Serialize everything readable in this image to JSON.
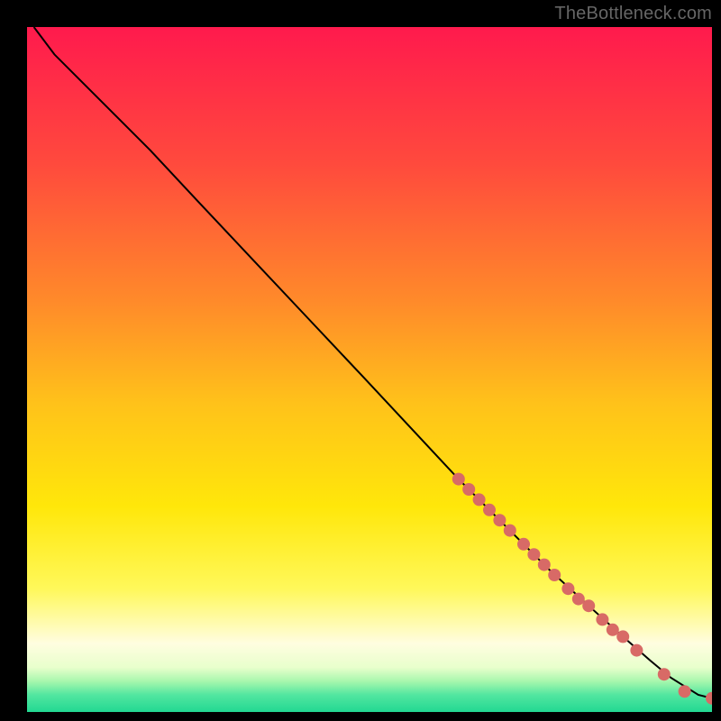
{
  "watermark": "TheBottleneck.com",
  "chart_data": {
    "type": "line",
    "title": "",
    "xlabel": "",
    "ylabel": "",
    "xlim": [
      0,
      100
    ],
    "ylim": [
      0,
      100
    ],
    "grid": false,
    "legend": false,
    "background_gradient_stops": [
      {
        "offset": 0.0,
        "color": "#ff1a4d"
      },
      {
        "offset": 0.2,
        "color": "#ff4a3d"
      },
      {
        "offset": 0.4,
        "color": "#ff8a2a"
      },
      {
        "offset": 0.55,
        "color": "#ffc21a"
      },
      {
        "offset": 0.7,
        "color": "#ffe70a"
      },
      {
        "offset": 0.82,
        "color": "#fff85a"
      },
      {
        "offset": 0.9,
        "color": "#fffde0"
      },
      {
        "offset": 0.935,
        "color": "#e8ffcc"
      },
      {
        "offset": 0.955,
        "color": "#a8f7ad"
      },
      {
        "offset": 0.975,
        "color": "#52e6a0"
      },
      {
        "offset": 1.0,
        "color": "#22d892"
      }
    ],
    "series": [
      {
        "name": "curve",
        "stroke": "#000000",
        "x": [
          1,
          4,
          8,
          12,
          18,
          25,
          33,
          41,
          49,
          56,
          63,
          70,
          76,
          82,
          87,
          91,
          94,
          98,
          100
        ],
        "y": [
          100,
          96,
          92,
          88,
          82,
          74.5,
          66,
          57.5,
          49,
          41.5,
          34,
          27,
          21,
          15.5,
          11,
          7.5,
          5,
          2.5,
          2
        ]
      }
    ],
    "markers": {
      "name": "highlight-points",
      "fill": "#d86a66",
      "radius_px": 7,
      "points": [
        {
          "x": 63,
          "y": 34
        },
        {
          "x": 64.5,
          "y": 32.5
        },
        {
          "x": 66,
          "y": 31
        },
        {
          "x": 67.5,
          "y": 29.5
        },
        {
          "x": 69,
          "y": 28
        },
        {
          "x": 70.5,
          "y": 26.5
        },
        {
          "x": 72.5,
          "y": 24.5
        },
        {
          "x": 74,
          "y": 23
        },
        {
          "x": 75.5,
          "y": 21.5
        },
        {
          "x": 77,
          "y": 20
        },
        {
          "x": 79,
          "y": 18
        },
        {
          "x": 80.5,
          "y": 16.5
        },
        {
          "x": 82,
          "y": 15.5
        },
        {
          "x": 84,
          "y": 13.5
        },
        {
          "x": 85.5,
          "y": 12
        },
        {
          "x": 87,
          "y": 11
        },
        {
          "x": 89,
          "y": 9
        },
        {
          "x": 93,
          "y": 5.5
        },
        {
          "x": 96,
          "y": 3
        },
        {
          "x": 100,
          "y": 2
        }
      ]
    }
  }
}
